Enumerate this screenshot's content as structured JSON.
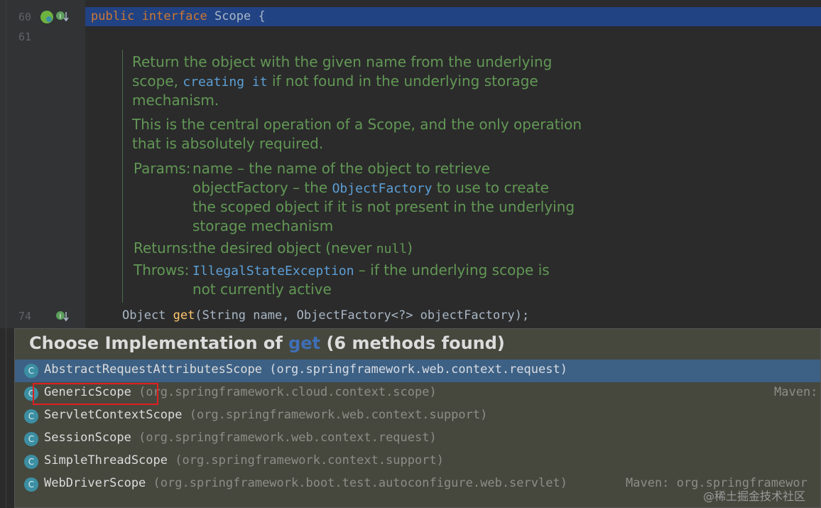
{
  "editor": {
    "line_numbers": {
      "l60": "60",
      "l61": "61",
      "l74": "74"
    },
    "line60": {
      "kw1": "public",
      "kw2": "interface",
      "name": "Scope",
      "brace": "{"
    },
    "doc": {
      "p1_a": "Return the object with the given name from the underlying",
      "p1_b_pre": "scope, ",
      "p1_b_code": "creating it",
      "p1_b_post": " if not found in the underlying storage",
      "p1_c": "mechanism.",
      "p2_a": "This is the central operation of a Scope, and the only operation",
      "p2_b": "that is absolutely required.",
      "params_label": "Params:",
      "param1": "name – the name of the object to retrieve",
      "param2_pre": "objectFactory – the ",
      "param2_code": "ObjectFactory",
      "param2_post": " to use to create",
      "param2_c": "the scoped object if it is not present in the underlying",
      "param2_d": "storage mechanism",
      "returns_label": "Returns:",
      "returns_pre": "the desired object (never ",
      "returns_code": "null",
      "returns_post": ")",
      "throws_label": "Throws:",
      "throws_code": "IllegalStateException",
      "throws_post": " – if the underlying scope is",
      "throws_b": "not currently active"
    },
    "line74": {
      "type": "Object",
      "method": "get",
      "params": "(String name, ObjectFactory<?> objectFactory);"
    }
  },
  "popup": {
    "title_pre": "Choose Implementation of ",
    "title_method": "get",
    "title_post": " (6 methods found)",
    "items": [
      {
        "name": "AbstractRequestAttributesScope",
        "pkg": "(org.springframework.web.context.request)",
        "icon": "C",
        "maven": ""
      },
      {
        "name": "GenericScope",
        "pkg": "(org.springframework.cloud.context.scope)",
        "icon": "C",
        "maven": "Maven:"
      },
      {
        "name": "ServletContextScope",
        "pkg": "(org.springframework.web.context.support)",
        "icon": "C",
        "maven": ""
      },
      {
        "name": "SessionScope",
        "pkg": "(org.springframework.web.context.request)",
        "icon": "C",
        "maven": ""
      },
      {
        "name": "SimpleThreadScope",
        "pkg": "(org.springframework.context.support)",
        "icon": "C",
        "maven": ""
      },
      {
        "name": "WebDriverScope",
        "pkg": "(org.springframework.boot.test.autoconfigure.web.servlet)",
        "icon": "C",
        "maven": "Maven: org.springframewor"
      }
    ]
  },
  "watermark": "@稀土掘金技术社区",
  "colors": {
    "selection": "#3d6185",
    "doc_text": "#629755",
    "keyword": "#cc7832",
    "highlight": "#e02020"
  }
}
